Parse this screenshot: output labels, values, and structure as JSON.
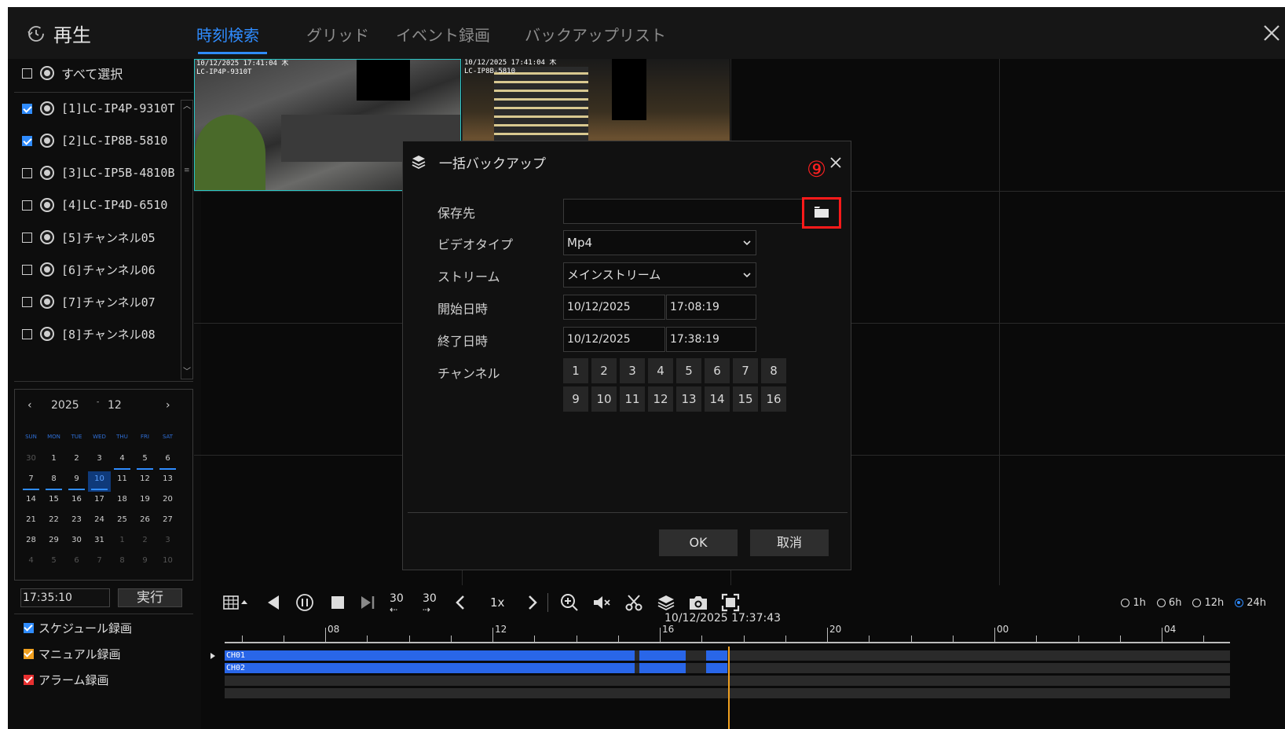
{
  "header": {
    "title": "再生",
    "tabs": [
      "時刻検索",
      "グリッド",
      "イベント録画",
      "バックアップリスト"
    ]
  },
  "sidebar": {
    "select_all": "すべて選択",
    "channels": [
      {
        "label": "[1]LC-IP4P-9310T",
        "checked": true
      },
      {
        "label": "[2]LC-IP8B-5810",
        "checked": true
      },
      {
        "label": "[3]LC-IP5B-4810B",
        "checked": false
      },
      {
        "label": "[4]LC-IP4D-6510",
        "checked": false
      },
      {
        "label": "[5]チャンネル05",
        "checked": false
      },
      {
        "label": "[6]チャンネル06",
        "checked": false
      },
      {
        "label": "[7]チャンネル07",
        "checked": false
      },
      {
        "label": "[8]チャンネル08",
        "checked": false
      }
    ],
    "calendar": {
      "year": "2025",
      "sep": "-",
      "month": "12",
      "dow": [
        "SUN",
        "MON",
        "TUE",
        "WED",
        "THU",
        "FRI",
        "SAT"
      ],
      "days": [
        "30",
        "1",
        "2",
        "3",
        "4",
        "5",
        "6",
        "7",
        "8",
        "9",
        "10",
        "11",
        "12",
        "13",
        "14",
        "15",
        "16",
        "17",
        "18",
        "19",
        "20",
        "21",
        "22",
        "23",
        "24",
        "25",
        "26",
        "27",
        "28",
        "29",
        "30",
        "31",
        "1",
        "2",
        "3",
        "4",
        "5",
        "6",
        "7",
        "8",
        "9",
        "10"
      ]
    },
    "time_value": "17:35:10",
    "exec_label": "実行",
    "legend": [
      {
        "label": "スケジュール録画",
        "color": "#2f8cff"
      },
      {
        "label": "マニュアル録画",
        "color": "#f0a020"
      },
      {
        "label": "アラーム録画",
        "color": "#e83030"
      }
    ]
  },
  "cameras": {
    "cam1_osd": "10/12/2025 17:41:04 木\nLC-IP4P-9310T",
    "cam2_osd": "10/12/2025 17:41:04 木\nLC-IP8B-5810"
  },
  "modal": {
    "title": "一括バックアップ",
    "annotation": "⑨",
    "fields": {
      "dest_label": "保存先",
      "dest_value": "",
      "video_type_label": "ビデオタイプ",
      "video_type_value": "Mp4",
      "stream_label": "ストリーム",
      "stream_value": "メインストリーム",
      "start_label": "開始日時",
      "start_date": "10/12/2025",
      "start_time": "17:08:19",
      "end_label": "終了日時",
      "end_date": "10/12/2025",
      "end_time": "17:38:19",
      "channel_label": "チャンネル"
    },
    "channels": [
      "1",
      "2",
      "3",
      "4",
      "5",
      "6",
      "7",
      "8",
      "9",
      "10",
      "11",
      "12",
      "13",
      "14",
      "15",
      "16"
    ],
    "ok_label": "OK",
    "cancel_label": "取消"
  },
  "toolbar": {
    "skip_back": "30",
    "skip_fwd": "30",
    "speed": "1x",
    "ranges": [
      {
        "label": "1h",
        "selected": false
      },
      {
        "label": "6h",
        "selected": false
      },
      {
        "label": "12h",
        "selected": false
      },
      {
        "label": "24h",
        "selected": true
      }
    ]
  },
  "timeline": {
    "cursor_time": "10/12/2025 17:37:43",
    "hour_labels": [
      "08",
      "12",
      "16",
      "20",
      "00",
      "04"
    ],
    "tracks": [
      "CH01",
      "CH02"
    ]
  },
  "colors": {
    "accent": "#2f8cff",
    "recording": "#2966e8",
    "playhead": "#f0a020",
    "annotation": "#ff1a1a"
  }
}
